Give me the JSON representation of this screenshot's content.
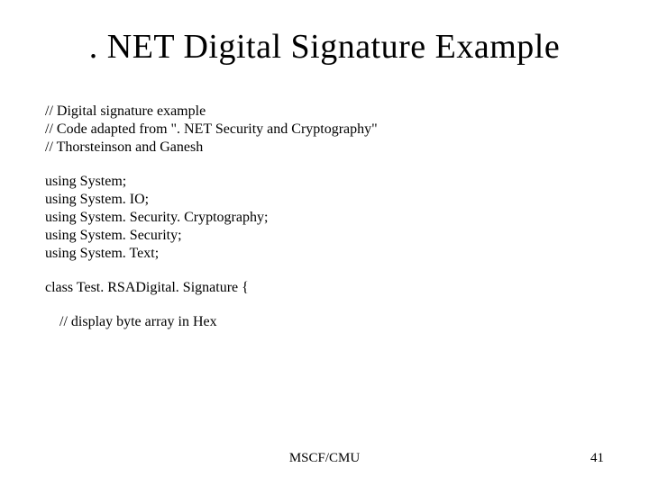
{
  "title": ". NET Digital Signature Example",
  "comments": {
    "l1": "// Digital signature example",
    "l2": "// Code adapted from \". NET Security and Cryptography\"",
    "l3": "// Thorsteinson and Ganesh"
  },
  "usings": {
    "l1": "using System;",
    "l2": "using System. IO;",
    "l3": "using System. Security. Cryptography;",
    "l4": "using System. Security;",
    "l5": "using System. Text;"
  },
  "classdecl": "class Test. RSADigital. Signature {",
  "inner_comment": "// display byte array in Hex",
  "footer": {
    "center": "MSCF/CMU",
    "page": "41"
  }
}
